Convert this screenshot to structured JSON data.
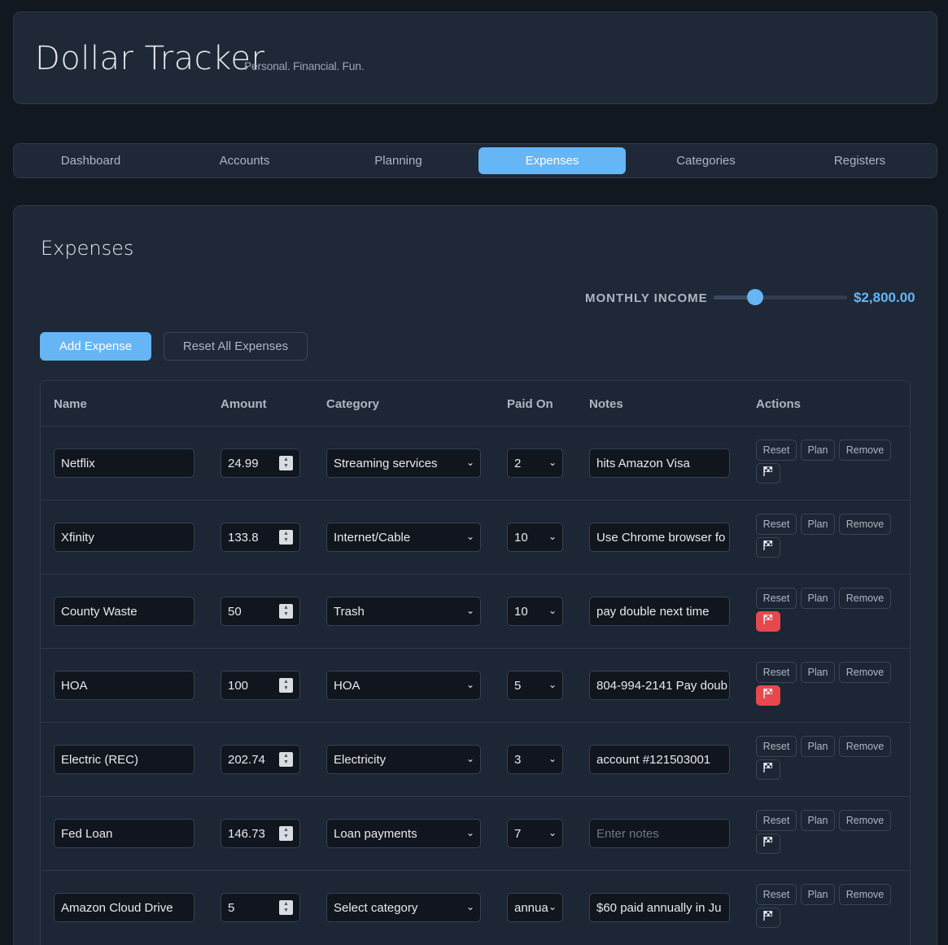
{
  "header": {
    "title": "Dollar Tracker",
    "tagline": "Personal. Financial. Fun."
  },
  "nav": {
    "tabs": [
      {
        "label": "Dashboard"
      },
      {
        "label": "Accounts"
      },
      {
        "label": "Planning"
      },
      {
        "label": "Expenses"
      },
      {
        "label": "Categories"
      },
      {
        "label": "Registers"
      }
    ],
    "active": "Expenses"
  },
  "page": {
    "title": "Expenses",
    "income_label": "MONTHLY INCOME",
    "income_value": "$2,800.00",
    "income_slider_fraction": 0.31,
    "add_button": "Add Expense",
    "reset_all_button": "Reset All Expenses"
  },
  "table": {
    "headers": {
      "name": "Name",
      "amount": "Amount",
      "category": "Category",
      "paid_on": "Paid On",
      "notes": "Notes",
      "actions": "Actions"
    },
    "action_labels": {
      "reset": "Reset",
      "plan": "Plan",
      "remove": "Remove"
    },
    "flag_icon": "checkered-flag-icon",
    "rows": [
      {
        "name": "Netflix",
        "amount": "24.99",
        "category": "Streaming services",
        "paid_on": "2",
        "notes": "hits Amazon Visa",
        "flag_active": false
      },
      {
        "name": "Xfinity",
        "amount": "133.8",
        "category": "Internet/Cable",
        "paid_on": "10",
        "notes": "Use Chrome browser fo",
        "flag_active": false
      },
      {
        "name": "County Waste",
        "amount": "50",
        "category": "Trash",
        "paid_on": "10",
        "notes": "pay double next time",
        "flag_active": true
      },
      {
        "name": "HOA",
        "amount": "100",
        "category": "HOA",
        "paid_on": "5",
        "notes": "804-994-2141 Pay doub",
        "flag_active": true
      },
      {
        "name": "Electric (REC)",
        "amount": "202.74",
        "category": "Electricity",
        "paid_on": "3",
        "notes": "account #121503001",
        "flag_active": false
      },
      {
        "name": "Fed Loan",
        "amount": "146.73",
        "category": "Loan payments",
        "paid_on": "7",
        "notes": "",
        "notes_placeholder": "Enter notes",
        "flag_active": false
      },
      {
        "name": "Amazon Cloud Drive",
        "amount": "5",
        "category": "Select category",
        "paid_on": "annua",
        "notes": "$60 paid annually in Ju",
        "flag_active": false
      }
    ]
  },
  "colors": {
    "accent": "#66b5f5",
    "danger": "#e5484d",
    "background": "#121820",
    "card": "#1e2836"
  }
}
